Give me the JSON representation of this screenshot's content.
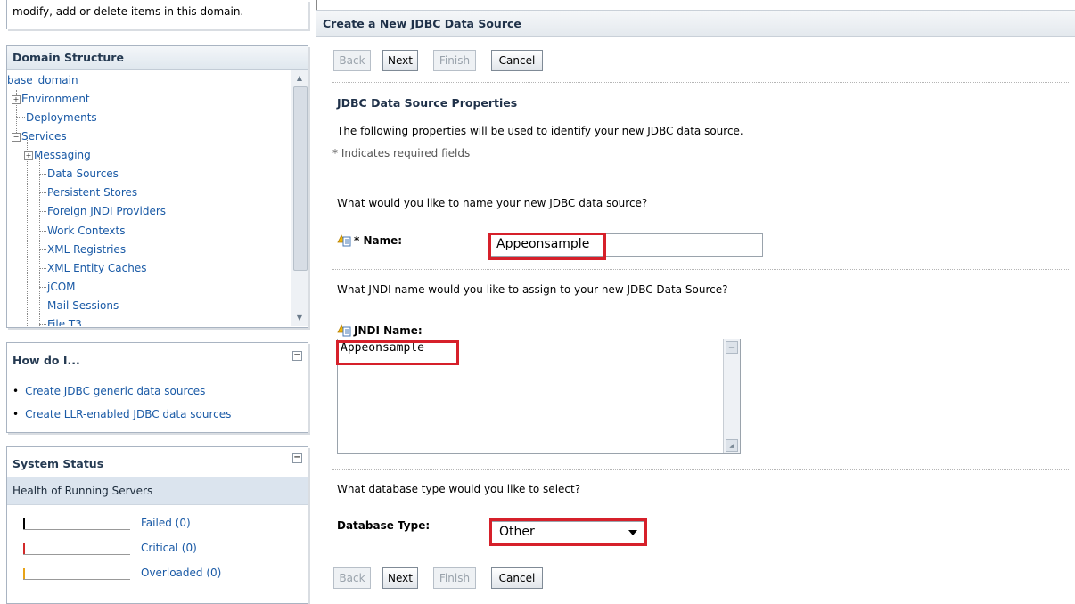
{
  "left": {
    "top_note": "modify, add or delete items in this domain.",
    "domain_structure": {
      "title": "Domain Structure",
      "root": "base_domain",
      "items": [
        "Environment",
        "Deployments",
        "Services",
        "Messaging",
        "Data Sources",
        "Persistent Stores",
        "Foreign JNDI Providers",
        "Work Contexts",
        "XML Registries",
        "XML Entity Caches",
        "jCOM",
        "Mail Sessions",
        "File T3"
      ]
    },
    "how_do_i": {
      "title": "How do I...",
      "links": [
        "Create JDBC generic data sources",
        "Create LLR-enabled JDBC data sources"
      ]
    },
    "system_status": {
      "title": "System Status",
      "subtitle": "Health of Running Servers",
      "rows": [
        {
          "label": "Failed (0)",
          "color": "#000000"
        },
        {
          "label": "Critical (0)",
          "color": "#d22a2a"
        },
        {
          "label": "Overloaded (0)",
          "color": "#e8a317"
        }
      ]
    }
  },
  "main": {
    "title": "Create a New JDBC Data Source",
    "buttons": {
      "back": "Back",
      "next": "Next",
      "finish": "Finish",
      "cancel": "Cancel"
    },
    "section_title": "JDBC Data Source Properties",
    "description": "The following properties will be used to identify your new JDBC data source.",
    "required_note": "* Indicates required fields",
    "q_name": "What would you like to name your new JDBC data source?",
    "name_label": "* Name:",
    "name_value": "Appeonsample",
    "q_jndi": "What JNDI name would you like to assign to your new JDBC Data Source?",
    "jndi_label": "JNDI Name:",
    "jndi_value": "Appeonsample",
    "q_db": "What database type would you like to select?",
    "db_label": "Database Type:",
    "db_value": "Other"
  },
  "colors": {
    "highlight": "#d6202a",
    "link": "#1a5aa6"
  }
}
